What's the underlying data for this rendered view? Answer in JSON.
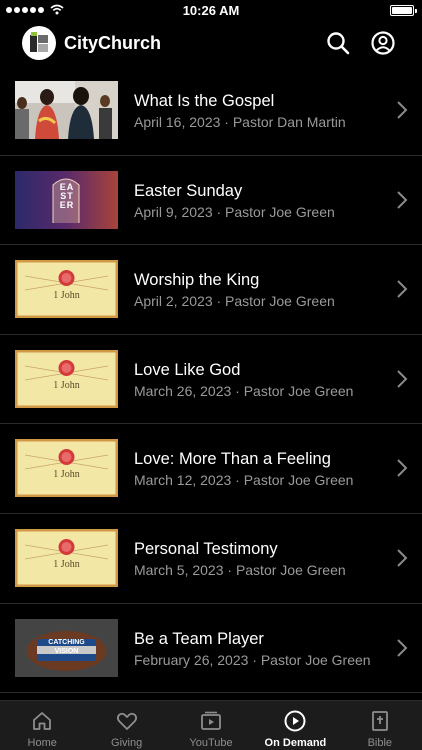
{
  "status_bar": {
    "time": "10:26 AM"
  },
  "header": {
    "app_name": "CityChurch",
    "search_icon": "search-icon",
    "account_icon": "account-icon"
  },
  "sermons": [
    {
      "title": "What Is the Gospel",
      "subtitle": "April 16, 2023 · Pastor Dan Martin",
      "thumbnail": "people-photo"
    },
    {
      "title": "Easter Sunday",
      "subtitle": "April 9, 2023 · Pastor Joe Green",
      "thumbnail": "easter-graphic",
      "thumb_text": "EASTER"
    },
    {
      "title": "Worship the King",
      "subtitle": "April 2, 2023 · Pastor Joe Green",
      "thumbnail": "1-john-graphic",
      "thumb_text": "1 John"
    },
    {
      "title": "Love Like God",
      "subtitle": "March 26, 2023 · Pastor Joe Green",
      "thumbnail": "1-john-graphic",
      "thumb_text": "1 John"
    },
    {
      "title": "Love: More Than a Feeling",
      "subtitle": "March 12, 2023 · Pastor Joe Green",
      "thumbnail": "1-john-graphic",
      "thumb_text": "1 John"
    },
    {
      "title": "Personal Testimony",
      "subtitle": "March 5, 2023 · Pastor Joe Green",
      "thumbnail": "1-john-graphic",
      "thumb_text": "1 John"
    },
    {
      "title": "Be a Team Player",
      "subtitle": "February 26, 2023 · Pastor Joe Green",
      "thumbnail": "catching-vision-graphic",
      "thumb_text": "CATCHING VISION"
    }
  ],
  "tabs": [
    {
      "label": "Home",
      "icon": "home-icon",
      "active": false
    },
    {
      "label": "Giving",
      "icon": "heart-icon",
      "active": false
    },
    {
      "label": "YouTube",
      "icon": "video-icon",
      "active": false
    },
    {
      "label": "On Demand",
      "icon": "play-circle-icon",
      "active": true
    },
    {
      "label": "Bible",
      "icon": "bible-icon",
      "active": false
    }
  ],
  "colors": {
    "background": "#000000",
    "subtitle": "#9a9a9a",
    "tabbar": "#1c1c1c",
    "inactive_tab": "#8e8e8e"
  }
}
